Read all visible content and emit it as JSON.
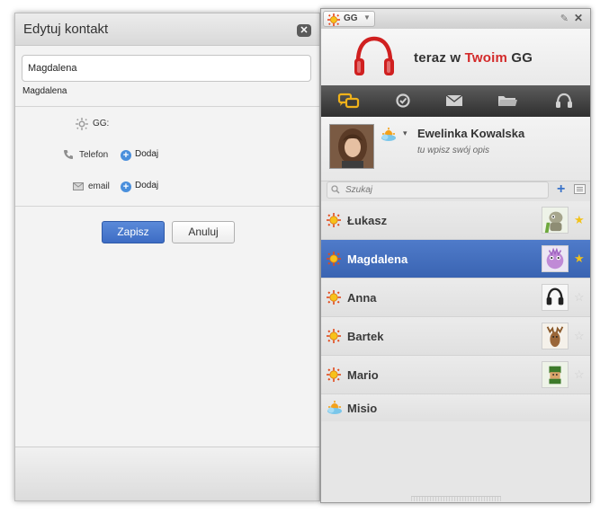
{
  "dialog": {
    "title": "Edytuj kontakt",
    "name_value": "Magdalena",
    "name_sub": "Magdalena",
    "gg_label": "GG:",
    "phone_label": "Telefon",
    "phone_add": "Dodaj",
    "email_label": "email",
    "email_add": "Dodaj",
    "save_label": "Zapisz",
    "cancel_label": "Anuluj"
  },
  "gg": {
    "menu_label": "GG",
    "banner": {
      "prefix": "teraz w ",
      "highlight": "Twoim",
      "suffix": " GG"
    },
    "toolbar": [
      "chat-icon",
      "status-icon",
      "mail-icon",
      "folder-icon",
      "headphones-icon"
    ],
    "profile": {
      "name": "Ewelinka Kowalska",
      "description": "tu wpisz swój opis"
    },
    "search_placeholder": "Szukaj",
    "contacts": [
      {
        "name": "Łukasz",
        "starred": true
      },
      {
        "name": "Magdalena",
        "starred": true,
        "selected": true
      },
      {
        "name": "Anna",
        "starred": false
      },
      {
        "name": "Bartek",
        "starred": false
      },
      {
        "name": "Mario",
        "starred": false
      },
      {
        "name": "Misio",
        "starred": false
      }
    ],
    "colors": {
      "accent_red": "#d32a2a",
      "selection_blue": "#3f68b6",
      "star_gold": "#f2c21a"
    }
  }
}
